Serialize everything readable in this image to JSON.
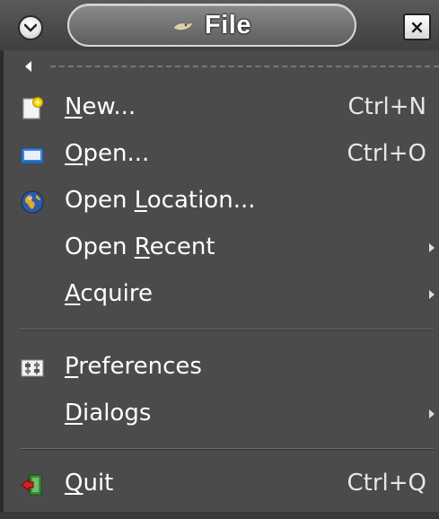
{
  "title": {
    "text": "File"
  },
  "close_label": "×",
  "menu_items": [
    {
      "pre": "",
      "mnemonic": "N",
      "post": "ew...",
      "accel": "Ctrl+N",
      "icon": "new-document-icon"
    },
    {
      "pre": "",
      "mnemonic": "O",
      "post": "pen...",
      "accel": "Ctrl+O",
      "icon": "open-folder-icon"
    },
    {
      "pre": "Open ",
      "mnemonic": "L",
      "post": "ocation...",
      "accel": "",
      "icon": "globe-icon"
    },
    {
      "pre": "Open ",
      "mnemonic": "R",
      "post": "ecent",
      "accel": "",
      "icon": "",
      "submenu": true
    },
    {
      "pre": "",
      "mnemonic": "A",
      "post": "cquire",
      "accel": "",
      "icon": "",
      "submenu": true
    },
    {
      "pre": "",
      "mnemonic": "P",
      "post": "references",
      "accel": "",
      "icon": "preferences-icon"
    },
    {
      "pre": "",
      "mnemonic": "D",
      "post": "ialogs",
      "accel": "",
      "icon": "",
      "submenu": true
    },
    {
      "pre": "",
      "mnemonic": "Q",
      "post": "uit",
      "accel": "Ctrl+Q",
      "icon": "quit-icon"
    }
  ],
  "colors": {
    "menu_bg": "#4b4b4b",
    "text": "#ffffff",
    "accent_yellow": "#f2d400"
  }
}
